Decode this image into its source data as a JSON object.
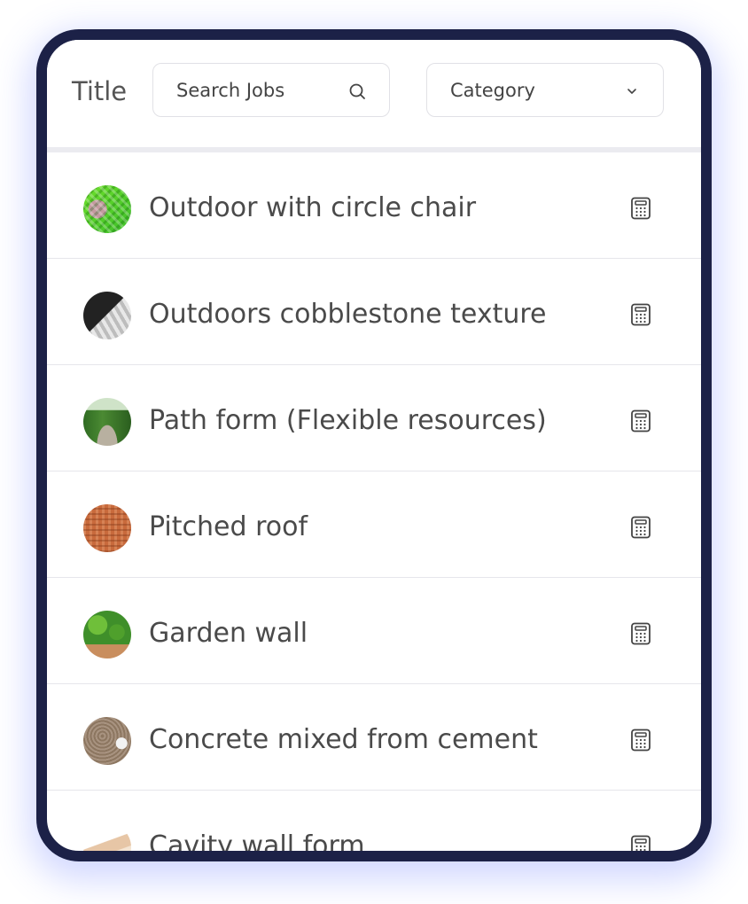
{
  "header": {
    "title": "Title",
    "search_placeholder": "Search Jobs",
    "category_label": "Category"
  },
  "items": [
    {
      "label": "Outdoor with circle chair",
      "thumb": "green-mesh"
    },
    {
      "label": "Outdoors cobblestone texture",
      "thumb": "cobblestone"
    },
    {
      "label": "Path form (Flexible resources)",
      "thumb": "garden-path"
    },
    {
      "label": "Pitched roof",
      "thumb": "roof-tiles"
    },
    {
      "label": "Garden wall",
      "thumb": "hedge-wall"
    },
    {
      "label": "Concrete mixed from cement",
      "thumb": "concrete"
    },
    {
      "label": "Cavity wall form",
      "thumb": "brick-wall"
    }
  ],
  "colors": {
    "frame": "#1c2147",
    "text": "#4a4a4a",
    "border": "#e1e1e6"
  }
}
